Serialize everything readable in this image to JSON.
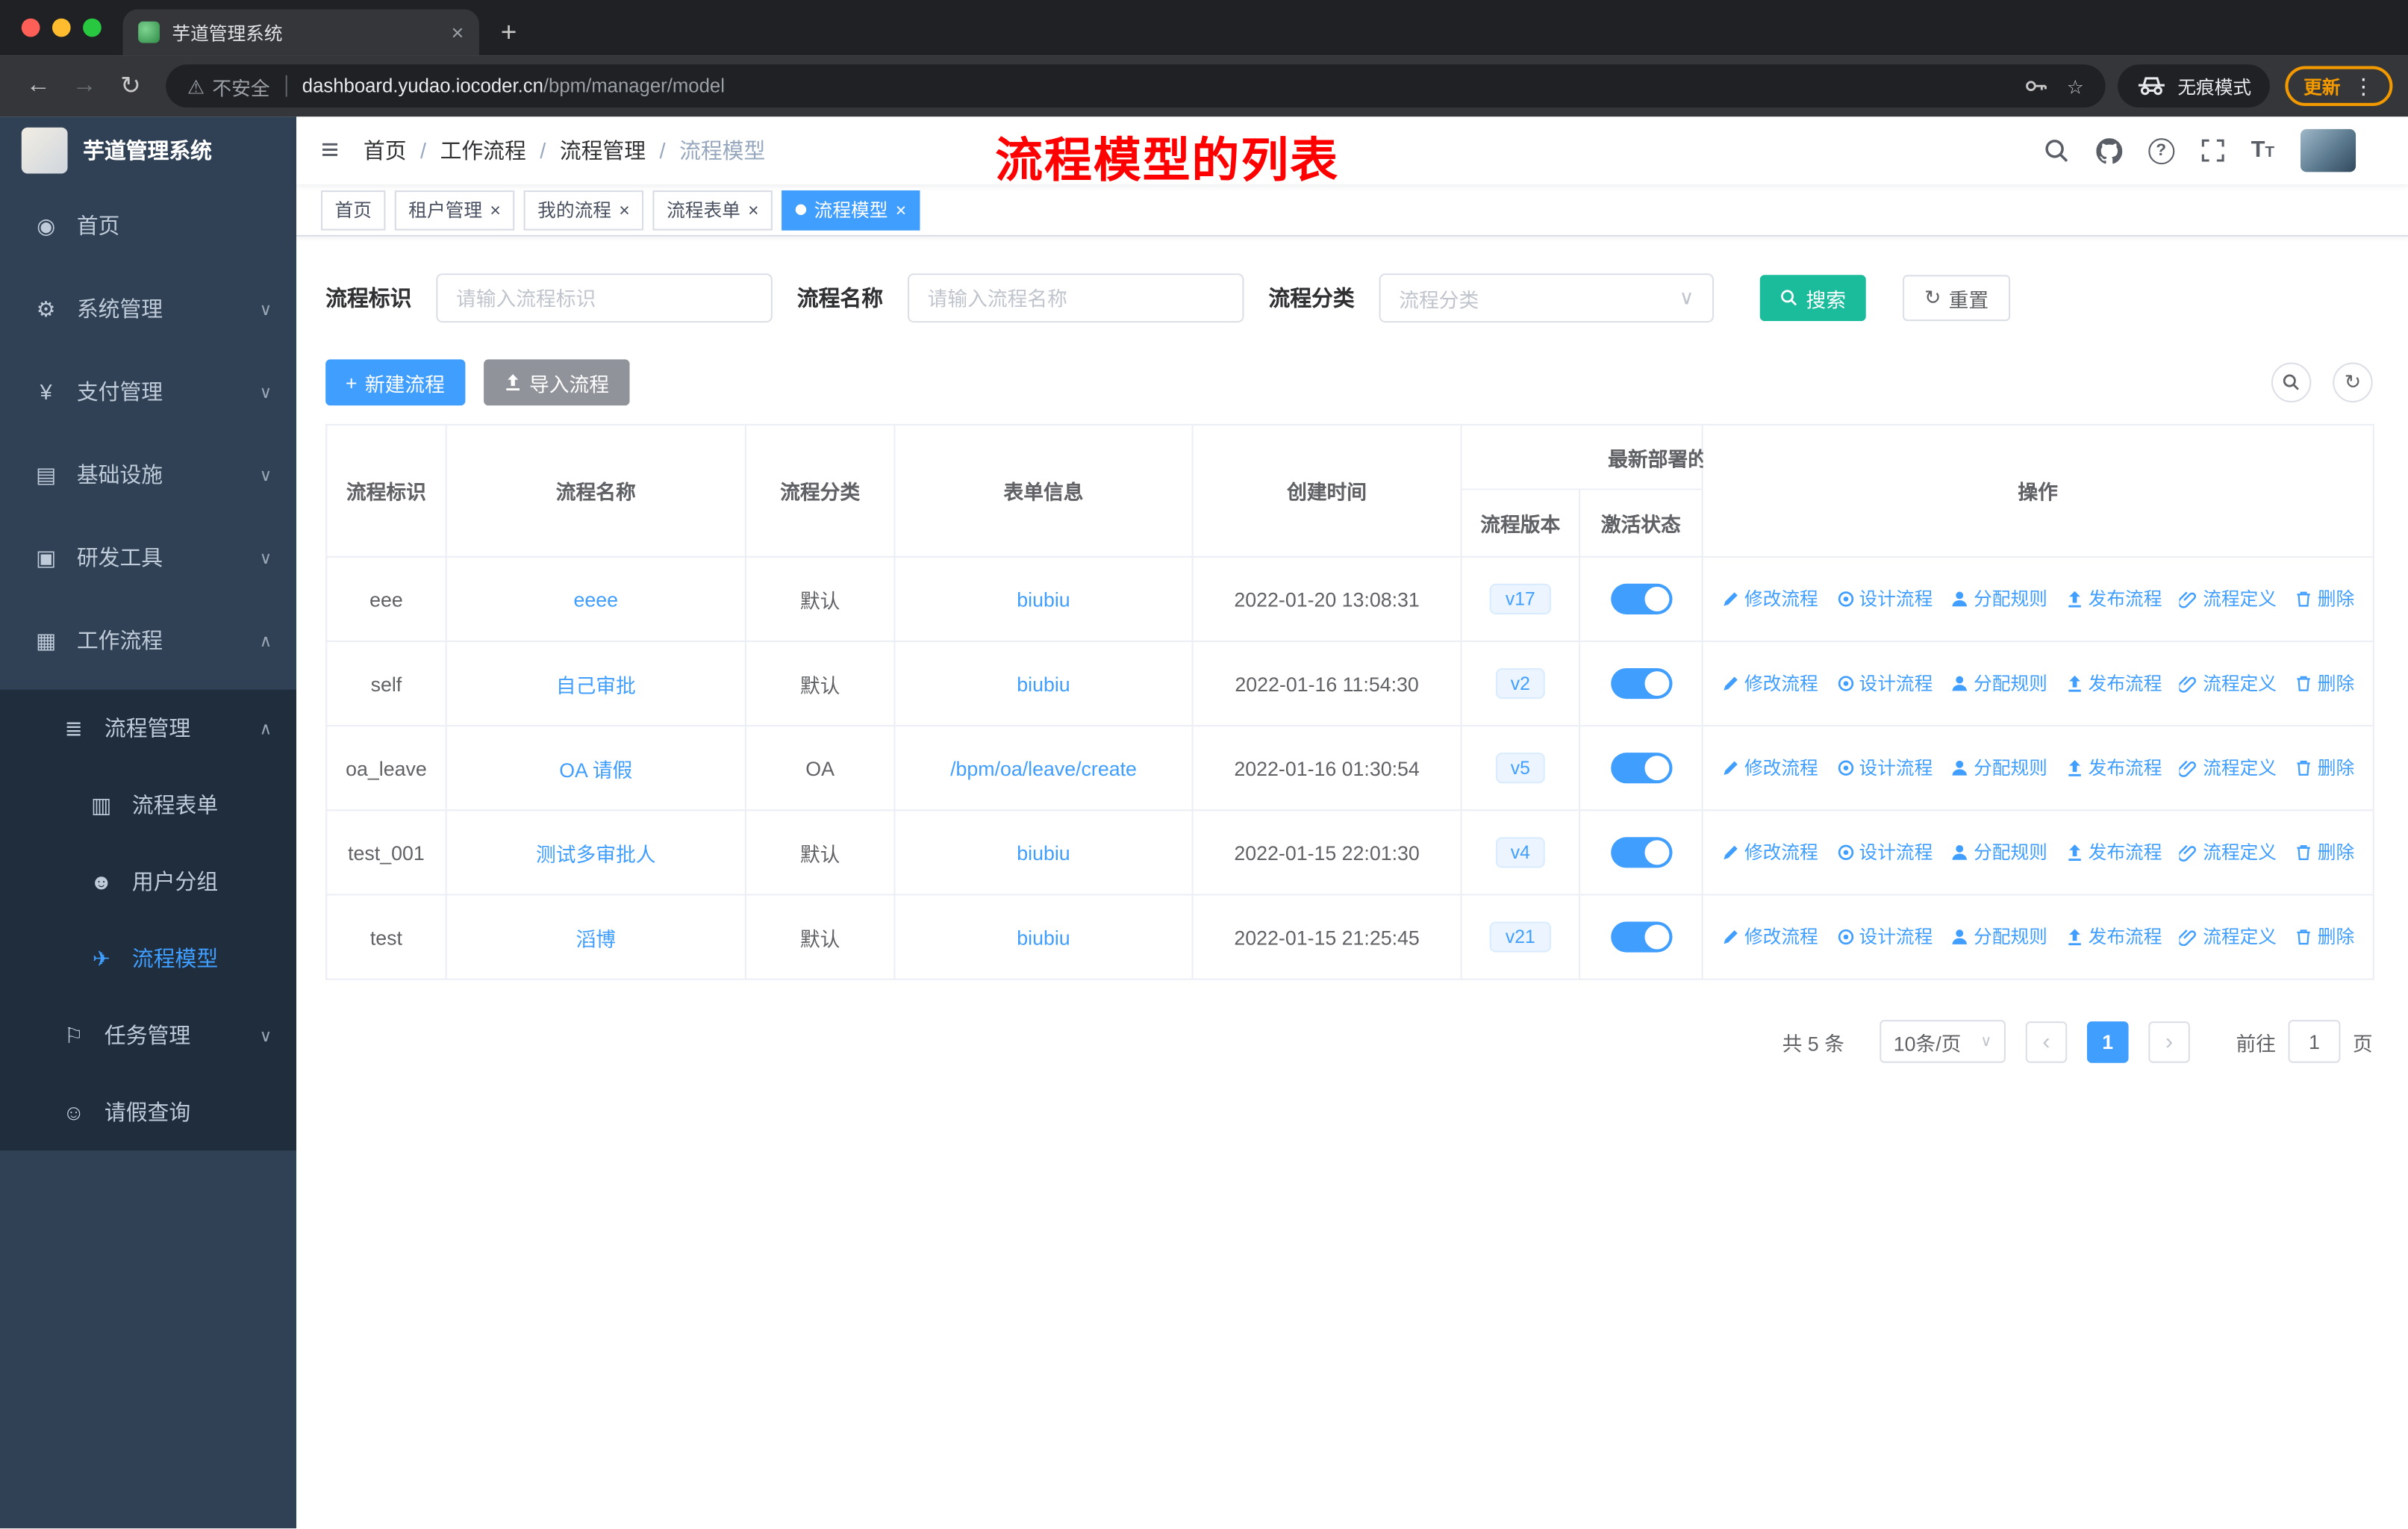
{
  "browser": {
    "tab_title": "芋道管理系统",
    "security_label": "不安全",
    "url_host": "dashboard.yudao.iocoder.cn",
    "url_path": "/bpm/manager/model",
    "incognito_label": "无痕模式",
    "update_label": "更新"
  },
  "icons": {
    "back": "←",
    "forward": "→",
    "reload": "↻",
    "warning": "⚠",
    "star": "☆",
    "more": "⋮",
    "new_tab": "+",
    "close": "×",
    "hamburger": "≡",
    "slash": "/",
    "chevron_down": "∨",
    "chevron_up": "∧",
    "home": "◉",
    "gear": "⚙",
    "yen": "¥",
    "infra": "▤",
    "tools": "▣",
    "workflow": "▦",
    "list": "≣",
    "form": "▥",
    "users": "☻",
    "send": "✈",
    "flag": "⚐",
    "person": "☺",
    "plus": "+",
    "refresh": "↻",
    "dot": "●",
    "prev": "‹",
    "next": "›",
    "question": "?",
    "font_size_big": "T",
    "font_size_small": "T"
  },
  "sidebar": {
    "logo_title": "芋道管理系统",
    "home": "首页",
    "system": "系统管理",
    "payment": "支付管理",
    "infra": "基础设施",
    "devtools": "研发工具",
    "workflow": "工作流程",
    "process_mgmt": "流程管理",
    "process_form": "流程表单",
    "user_group": "用户分组",
    "process_model": "流程模型",
    "task_mgmt": "任务管理",
    "leave_query": "请假查询"
  },
  "navbar": {
    "breadcrumb": [
      "首页",
      "工作流程",
      "流程管理",
      "流程模型"
    ],
    "annotation": "流程模型的列表"
  },
  "tags": [
    {
      "label": "首页"
    },
    {
      "label": "租户管理"
    },
    {
      "label": "我的流程"
    },
    {
      "label": "流程表单"
    },
    {
      "label": "流程模型"
    }
  ],
  "filters": {
    "key_label": "流程标识",
    "key_placeholder": "请输入流程标识",
    "name_label": "流程名称",
    "name_placeholder": "请输入流程名称",
    "category_label": "流程分类",
    "category_placeholder": "流程分类",
    "search": "搜索",
    "reset": "重置"
  },
  "toolbar": {
    "create": "新建流程",
    "import": "导入流程"
  },
  "table": {
    "headers": {
      "key": "流程标识",
      "name": "流程名称",
      "category": "流程分类",
      "form": "表单信息",
      "created": "创建时间",
      "deploy_group": "最新部署的",
      "version": "流程版本",
      "active": "激活状态",
      "actions": "操作"
    },
    "action_labels": [
      "修改流程",
      "设计流程",
      "分配规则",
      "发布流程",
      "流程定义",
      "删除"
    ],
    "rows": [
      {
        "key": "eee",
        "name": "eeee",
        "category": "默认",
        "form": "biubiu",
        "created": "2022-01-20 13:08:31",
        "version": "v17",
        "active": true
      },
      {
        "key": "self",
        "name": "自己审批",
        "category": "默认",
        "form": "biubiu",
        "created": "2022-01-16 11:54:30",
        "version": "v2",
        "active": true
      },
      {
        "key": "oa_leave",
        "name": "OA 请假",
        "category": "OA",
        "form": "/bpm/oa/leave/create",
        "created": "2022-01-16 01:30:54",
        "version": "v5",
        "active": true
      },
      {
        "key": "test_001",
        "name": "测试多审批人",
        "category": "默认",
        "form": "biubiu",
        "created": "2022-01-15 22:01:30",
        "version": "v4",
        "active": true
      },
      {
        "key": "test",
        "name": "滔博",
        "category": "默认",
        "form": "biubiu",
        "created": "2022-01-15 21:25:45",
        "version": "v21",
        "active": true
      }
    ]
  },
  "pagination": {
    "total": "共 5 条",
    "page_size": "10条/页",
    "current_page": "1",
    "goto_label": "前往",
    "goto_value": "1",
    "page_unit": "页"
  },
  "colors": {
    "primary": "#409eff",
    "search_button": "#1abc9c",
    "import_button": "#909399",
    "annotation_red": "#ff0000",
    "sidebar_bg": "#304156",
    "submenu_bg": "#1f2d3d",
    "link": "#409eff",
    "version_tag_bg": "#ecf5ff",
    "update_pill": "#f29900"
  }
}
